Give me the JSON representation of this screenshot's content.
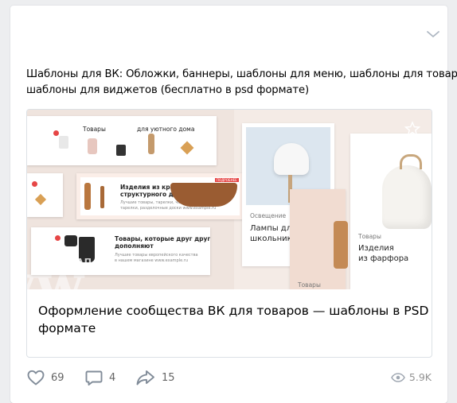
{
  "post": {
    "text_lines": [
      "Шаблоны для ВК: Обложки, баннеры, шаблоны для меню, шаблоны для товаров,",
      "шаблоны для виджетов (бесплатно в psd формате)"
    ]
  },
  "attachment": {
    "title_lines": [
      "Оформление сообщества ВК для товаров — шаблоны в PSD",
      "формате"
    ],
    "image": {
      "banner1": {
        "title_left": "Товары",
        "title_right": "для уютного дома"
      },
      "banner2": {
        "title": "Изделия из красного",
        "title2": "структурного дерева",
        "sub1": "Лучшие товары, тарелки, чайники,",
        "sub2": "тарелки, разделочные доски  www.example.ru",
        "badge": "ПОДРОБНЕЕ"
      },
      "banner3": {
        "title": "Товары, которые друг друга",
        "title2": "дополняют",
        "sub1": "Лучшие товары европейского качества",
        "sub2": "в нашем магазине  www.example.ru"
      },
      "watermark": "МОКАП",
      "tile_lamps": {
        "label": "Освещение",
        "title1": "Лампы для",
        "title2": "школьник"
      },
      "tile_goods": {
        "label": "Товары"
      },
      "tile_porcelain": {
        "label": "Товары",
        "title1": "Изделия",
        "title2": "из фарфора"
      }
    }
  },
  "actions": {
    "likes": "69",
    "comments": "4",
    "shares": "15",
    "views": "5.9K"
  },
  "colors": {
    "icon": "#818c99",
    "count": "#656565",
    "beige": "#f4ebe6",
    "blue_tile": "#dce6ef",
    "accent_red": "#e64646"
  }
}
